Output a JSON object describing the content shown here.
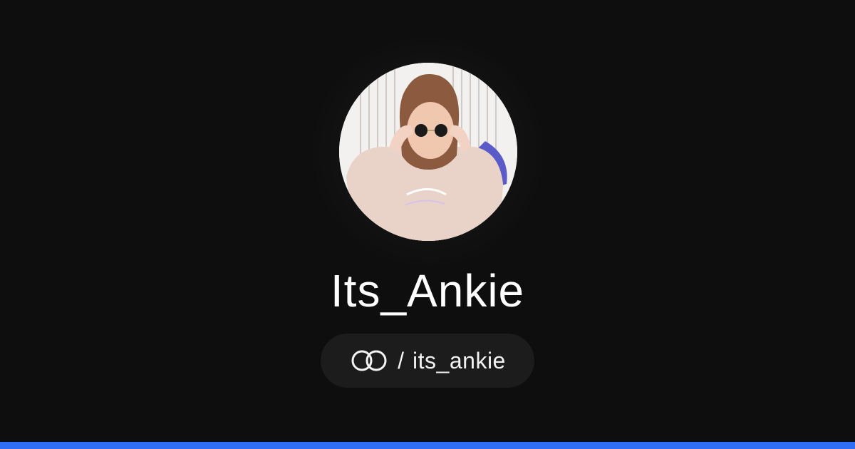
{
  "profile": {
    "display_name": "Its_Ankie",
    "handle_separator": "/",
    "handle": "its_ankie",
    "avatar_alt": "profile photo"
  },
  "icons": {
    "platform": "linked-rings-icon"
  },
  "colors": {
    "background": "#0e0e0e",
    "pill": "#1c1c1c",
    "accent_bar": "#2f6ef5",
    "text": "#ffffff"
  }
}
